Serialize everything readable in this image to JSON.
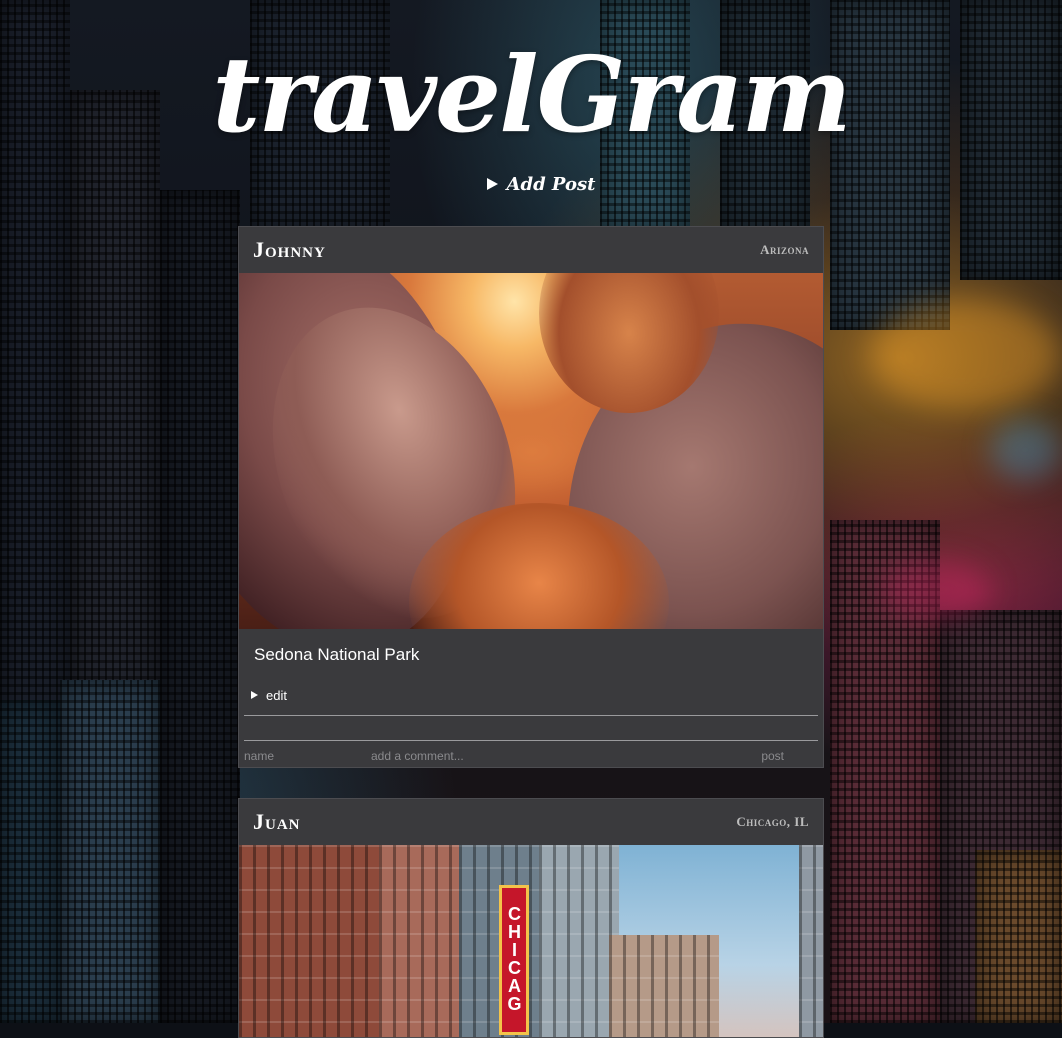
{
  "app": {
    "title": "travelGram",
    "add_post_label": "Add Post"
  },
  "posts": [
    {
      "author": "Johnny",
      "location": "Arizona",
      "caption": "Sedona National Park",
      "edit_label": "edit",
      "comment_form": {
        "name_placeholder": "name",
        "comment_placeholder": "add a comment...",
        "post_label": "post"
      },
      "photo": "slot canyon"
    },
    {
      "author": "Juan",
      "location": "Chicago, IL",
      "photo": "city street",
      "sign_text": "CHICAG"
    }
  ],
  "colors": {
    "card_background": "#3a3a3d",
    "text": "#ffffff",
    "location_text": "#bdbdbd",
    "placeholder": "#8a8a8d"
  }
}
